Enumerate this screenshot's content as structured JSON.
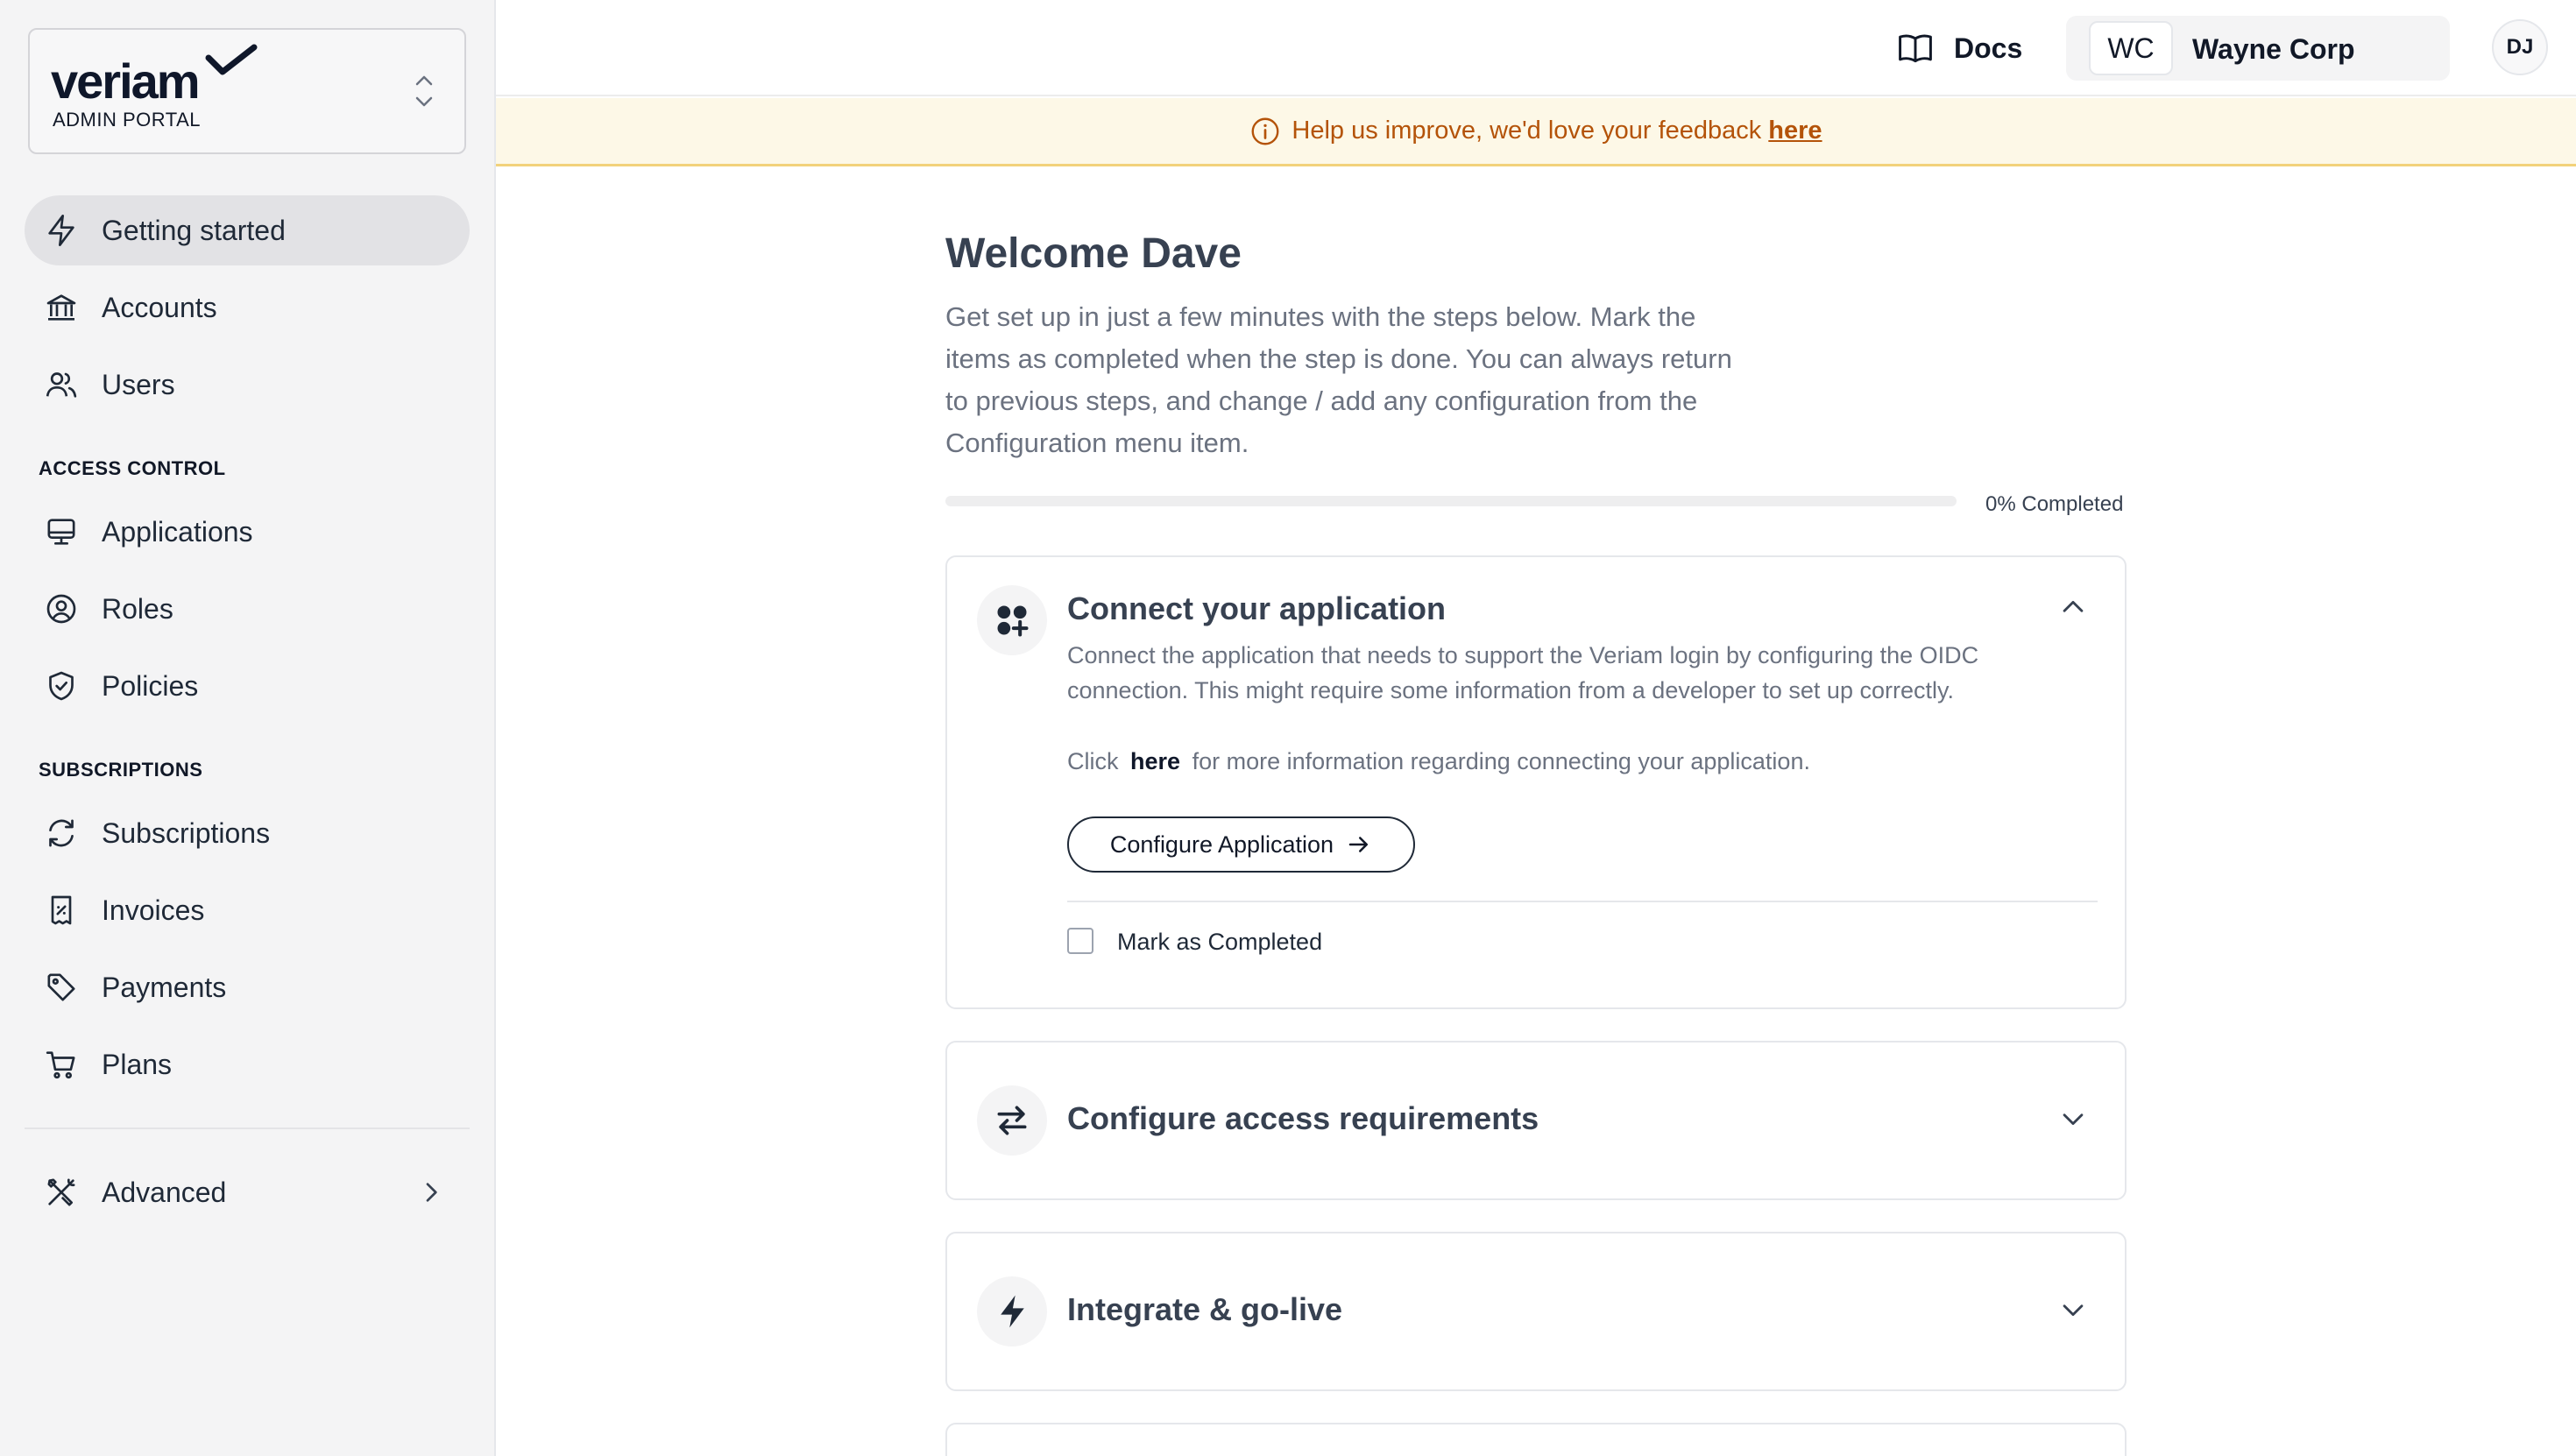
{
  "brand": {
    "name": "veriam",
    "subtitle": "ADMIN PORTAL"
  },
  "sidebar": {
    "items": [
      {
        "label": "Getting started",
        "icon": "bolt-icon",
        "active": true
      },
      {
        "label": "Accounts",
        "icon": "bank-icon"
      },
      {
        "label": "Users",
        "icon": "users-icon"
      }
    ],
    "access_control": {
      "title": "ACCESS CONTROL",
      "items": [
        {
          "label": "Applications",
          "icon": "monitor-icon"
        },
        {
          "label": "Roles",
          "icon": "user-circle-icon"
        },
        {
          "label": "Policies",
          "icon": "shield-icon"
        }
      ]
    },
    "subscriptions": {
      "title": "SUBSCRIPTIONS",
      "items": [
        {
          "label": "Subscriptions",
          "icon": "refresh-icon"
        },
        {
          "label": "Invoices",
          "icon": "receipt-icon"
        },
        {
          "label": "Payments",
          "icon": "tag-icon"
        },
        {
          "label": "Plans",
          "icon": "cart-icon"
        }
      ]
    },
    "advanced": {
      "label": "Advanced",
      "icon": "tools-icon"
    }
  },
  "topbar": {
    "docs_label": "Docs",
    "org_initials": "WC",
    "org_name": "Wayne Corp",
    "user_initials": "DJ"
  },
  "banner": {
    "text": "Help us improve, we'd love your feedback",
    "link": "here"
  },
  "main": {
    "welcome": "Welcome Dave",
    "intro": "Get set up in just a few minutes with the steps below. Mark the items as completed when the step is done. You can always return to previous steps, and change / add any configuration from the Configuration menu item.",
    "progress_percent": 0,
    "progress_label": "0% Completed",
    "steps": [
      {
        "title": "Connect your application",
        "expanded": true,
        "description": "Connect the application that needs to support the Veriam login by configuring the OIDC connection. This might require some information from a developer to set up correctly.",
        "link_prefix": "Click",
        "link_text": "here",
        "link_suffix": "for more information regarding connecting your application.",
        "button_label": "Configure Application",
        "checkbox_label": "Mark as Completed"
      },
      {
        "title": "Configure access requirements",
        "expanded": false
      },
      {
        "title": "Integrate & go-live",
        "expanded": false
      }
    ]
  },
  "colors": {
    "sidebar_bg": "#f4f4f5",
    "active_item_bg": "#e2e2e5",
    "banner_bg": "#fdf8e7",
    "banner_text": "#b45309",
    "banner_border": "#f2d27a"
  }
}
